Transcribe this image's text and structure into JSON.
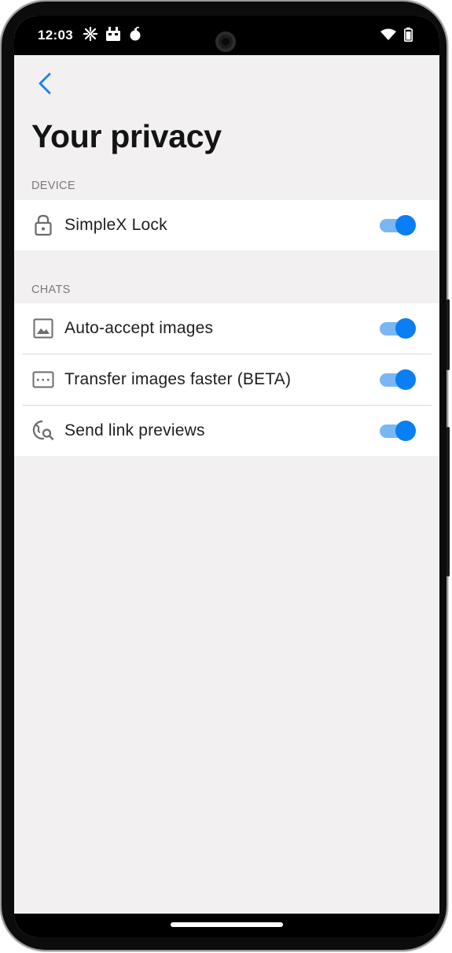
{
  "status_bar": {
    "time": "12:03",
    "left_icons": [
      "cross-arrows-icon",
      "android-robot-icon",
      "bomb-icon"
    ],
    "right_icons": [
      "wifi-icon",
      "battery-icon"
    ]
  },
  "header": {
    "back_icon": "chevron-left-icon",
    "title": "Your privacy"
  },
  "sections": {
    "device": {
      "header": "DEVICE",
      "items": [
        {
          "label": "SimpleX Lock",
          "icon": "lock-icon",
          "enabled": true
        }
      ]
    },
    "chats": {
      "header": "CHATS",
      "items": [
        {
          "label": "Auto-accept images",
          "icon": "image-icon",
          "enabled": true
        },
        {
          "label": "Transfer images faster (BETA)",
          "icon": "dotted-frame-icon",
          "enabled": true
        },
        {
          "label": "Send link previews",
          "icon": "globe-search-icon",
          "enabled": true
        }
      ]
    }
  },
  "colors": {
    "accent": "#0a7ef5",
    "toggle_track": "#7ab6f2",
    "background": "#f2f0f1",
    "card": "#ffffff",
    "section_text": "#7a7a7a"
  }
}
